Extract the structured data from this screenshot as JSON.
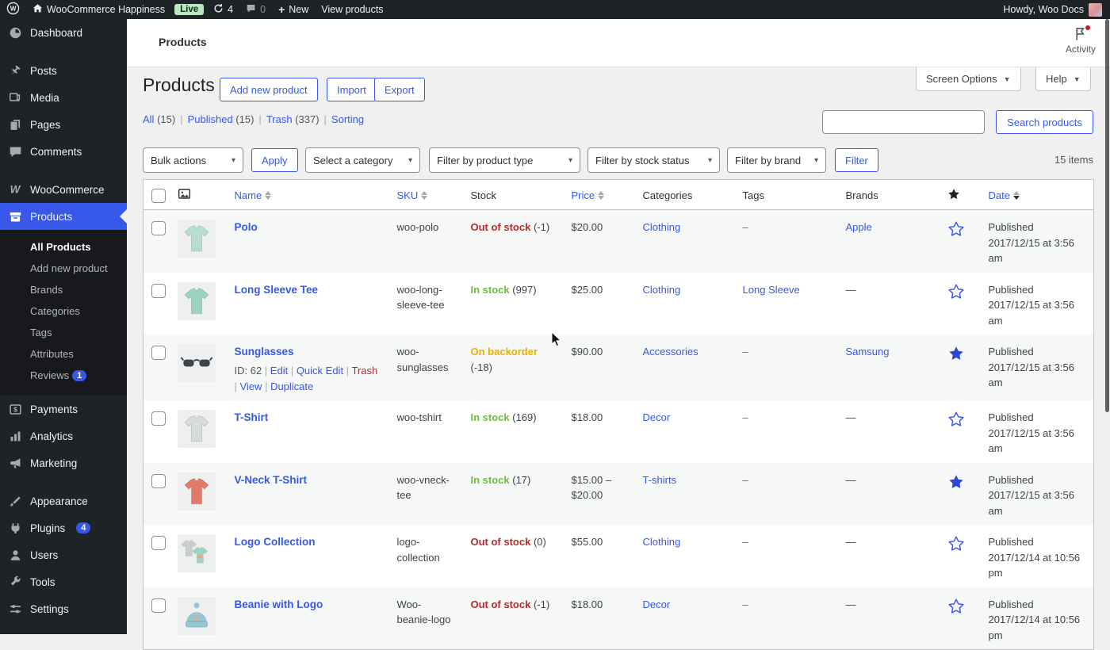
{
  "colors": {
    "accent": "#3858e9",
    "in_stock": "#6ebe3c",
    "out_of_stock": "#b32d2e",
    "backorder": "#eab000",
    "admin_dark": "#1d2327"
  },
  "admin_bar": {
    "site_name": "WooCommerce Happiness",
    "live_badge": "Live",
    "updates_count": "4",
    "comments_count": "0",
    "new_label": "New",
    "view_products_label": "View products",
    "howdy": "Howdy, Woo Docs"
  },
  "sidebar": {
    "items": [
      {
        "label": "Dashboard",
        "icon": "dashboard",
        "gap": false
      },
      {
        "label": "Posts",
        "icon": "posts",
        "gap": true
      },
      {
        "label": "Media",
        "icon": "media",
        "gap": false
      },
      {
        "label": "Pages",
        "icon": "pages",
        "gap": false
      },
      {
        "label": "Comments",
        "icon": "comments",
        "gap": false
      },
      {
        "label": "WooCommerce",
        "icon": "woo",
        "gap": true
      },
      {
        "label": "Products",
        "icon": "products",
        "gap": false,
        "active": true
      },
      {
        "label": "Payments",
        "icon": "payments",
        "gap": false
      },
      {
        "label": "Analytics",
        "icon": "analytics",
        "gap": false
      },
      {
        "label": "Marketing",
        "icon": "marketing",
        "gap": false
      },
      {
        "label": "Appearance",
        "icon": "appearance",
        "gap": true
      },
      {
        "label": "Plugins",
        "icon": "plugins",
        "gap": false,
        "badge": "4"
      },
      {
        "label": "Users",
        "icon": "users",
        "gap": false
      },
      {
        "label": "Tools",
        "icon": "tools",
        "gap": false
      },
      {
        "label": "Settings",
        "icon": "settings",
        "gap": false
      }
    ],
    "submenu": [
      {
        "label": "All Products",
        "current": true
      },
      {
        "label": "Add new product"
      },
      {
        "label": "Brands"
      },
      {
        "label": "Categories"
      },
      {
        "label": "Tags"
      },
      {
        "label": "Attributes"
      },
      {
        "label": "Reviews",
        "badge": "1"
      }
    ]
  },
  "wc_header": {
    "breadcrumb": "Products",
    "activity_label": "Activity"
  },
  "tabs": {
    "screen_options": "Screen Options",
    "help": "Help"
  },
  "page": {
    "title": "Products",
    "add_new": "Add new product",
    "import": "Import",
    "export": "Export",
    "views": [
      {
        "label": "All",
        "count": "(15)"
      },
      {
        "label": "Published",
        "count": "(15)"
      },
      {
        "label": "Trash",
        "count": "(337)"
      },
      {
        "label": "Sorting",
        "count": ""
      }
    ],
    "search_placeholder": "",
    "search_button": "Search products",
    "items_count": "15 items"
  },
  "filters": {
    "bulk_actions": "Bulk actions",
    "apply": "Apply",
    "category": "Select a category",
    "product_type": "Filter by product type",
    "stock_status": "Filter by stock status",
    "brand": "Filter by brand",
    "filter_button": "Filter"
  },
  "table": {
    "headers": {
      "name": "Name",
      "sku": "SKU",
      "stock": "Stock",
      "price": "Price",
      "categories": "Categories",
      "tags": "Tags",
      "brands": "Brands",
      "date": "Date"
    },
    "rows": [
      {
        "name": "Polo",
        "sku": "woo-polo",
        "stock_label": "Out of stock",
        "stock_qty": "(-1)",
        "stock_state": "out",
        "price": "$20.00",
        "categories": "Clothing",
        "tags": "–",
        "brands": "Apple",
        "brands_link": true,
        "featured": false,
        "date": "Published 2017/12/15 at 3:56 am",
        "thumb_kind": "shirt",
        "thumb_color": "#b7ddd3"
      },
      {
        "name": "Long Sleeve Tee",
        "sku": "woo-long-sleeve-tee",
        "stock_label": "In stock",
        "stock_qty": "(997)",
        "stock_state": "in",
        "price": "$25.00",
        "categories": "Clothing",
        "tags": "Long Sleeve",
        "tags_link": true,
        "brands": "—",
        "featured": false,
        "date": "Published 2017/12/15 at 3:56 am",
        "thumb_kind": "shirt",
        "thumb_color": "#9dd4c0"
      },
      {
        "name": "Sunglasses",
        "sku": "woo-sunglasses",
        "stock_label": "On backorder",
        "stock_qty": "(-18)",
        "stock_state": "backorder",
        "price": "$90.00",
        "categories": "Accessories",
        "tags": "–",
        "brands": "Samsung",
        "brands_link": true,
        "featured": true,
        "date": "Published 2017/12/15 at 3:56 am",
        "thumb_kind": "sunglasses",
        "thumb_color": "#3c434a",
        "actions": {
          "id_text": "ID: 62",
          "links": [
            "Edit",
            "Quick Edit",
            "Trash",
            "View",
            "Duplicate"
          ]
        }
      },
      {
        "name": "T-Shirt",
        "sku": "woo-tshirt",
        "stock_label": "In stock",
        "stock_qty": "(169)",
        "stock_state": "in",
        "price": "$18.00",
        "categories": "Decor",
        "tags": "–",
        "brands": "—",
        "featured": false,
        "date": "Published 2017/12/15 at 3:56 am",
        "thumb_kind": "shirt",
        "thumb_color": "#d8dbdc"
      },
      {
        "name": "V-Neck T-Shirt",
        "sku": "woo-vneck-tee",
        "stock_label": "In stock",
        "stock_qty": "(17)",
        "stock_state": "in",
        "price": "$15.00 – $20.00",
        "categories": "T-shirts",
        "tags": "–",
        "brands": "—",
        "featured": true,
        "date": "Published 2017/12/15 at 3:56 am",
        "thumb_kind": "shirt",
        "thumb_color": "#e2796b"
      },
      {
        "name": "Logo Collection",
        "sku": "logo-collection",
        "stock_label": "Out of stock",
        "stock_qty": "(0)",
        "stock_state": "out",
        "price": "$55.00",
        "categories": "Clothing",
        "tags": "–",
        "brands": "—",
        "featured": false,
        "date": "Published 2017/12/14 at 10:56 pm",
        "thumb_kind": "collection",
        "thumb_color": "#9dd4c0"
      },
      {
        "name": "Beanie with Logo",
        "sku": "Woo-beanie-logo",
        "stock_label": "Out of stock",
        "stock_qty": "(-1)",
        "stock_state": "out",
        "price": "$18.00",
        "categories": "Decor",
        "tags": "–",
        "brands": "—",
        "featured": false,
        "date": "Published 2017/12/14 at 10:56 pm",
        "thumb_kind": "beanie",
        "thumb_color": "#96c8d4"
      }
    ]
  }
}
